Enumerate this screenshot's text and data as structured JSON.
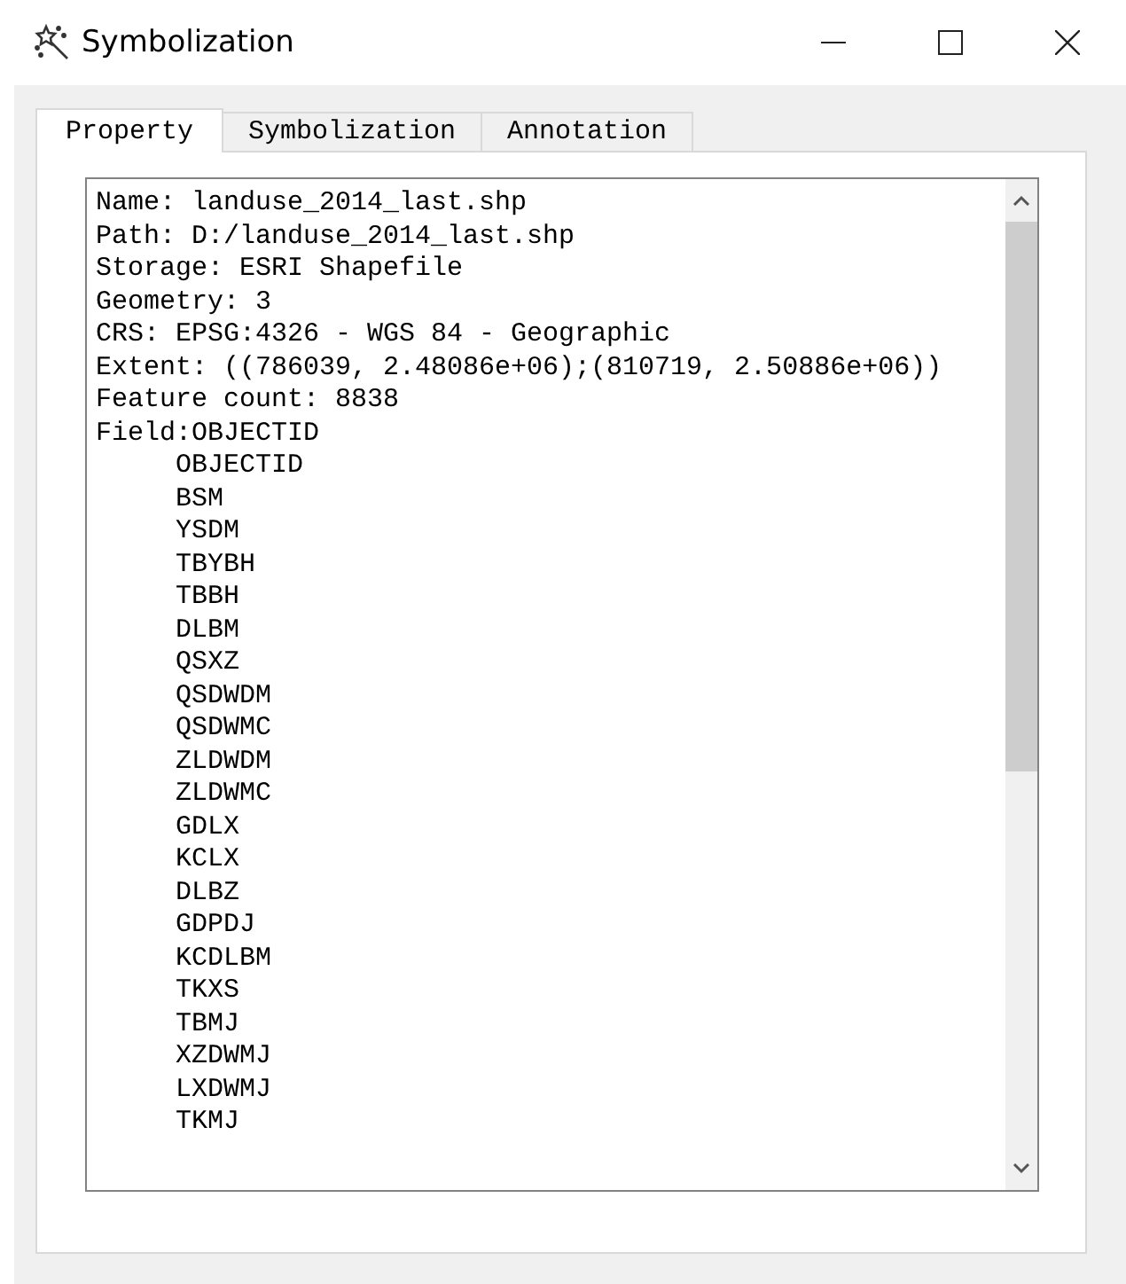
{
  "window": {
    "title": "Symbolization"
  },
  "tabs": [
    {
      "label": "Property",
      "selected": true
    },
    {
      "label": "Symbolization",
      "selected": false
    },
    {
      "label": "Annotation",
      "selected": false
    }
  ],
  "properties": [
    "Name: landuse_2014_last.shp",
    "Path: D:/landuse_2014_last.shp",
    "Storage: ESRI Shapefile",
    "Geometry: 3",
    "CRS: EPSG:4326 - WGS 84 - Geographic",
    "Extent: ((786039, 2.48086e+06);(810719, 2.50886e+06))",
    "Feature count: 8838",
    "Field:OBJECTID"
  ],
  "fields": [
    "OBJECTID",
    "BSM",
    "YSDM",
    "TBYBH",
    "TBBH",
    "DLBM",
    "QSXZ",
    "QSDWDM",
    "QSDWMC",
    "ZLDWDM",
    "ZLDWMC",
    "GDLX",
    "KCLX",
    "DLBZ",
    "GDPDJ",
    "KCDLBM",
    "TKXS",
    "TBMJ",
    "XZDWMJ",
    "LXDWMJ",
    "TKMJ"
  ]
}
